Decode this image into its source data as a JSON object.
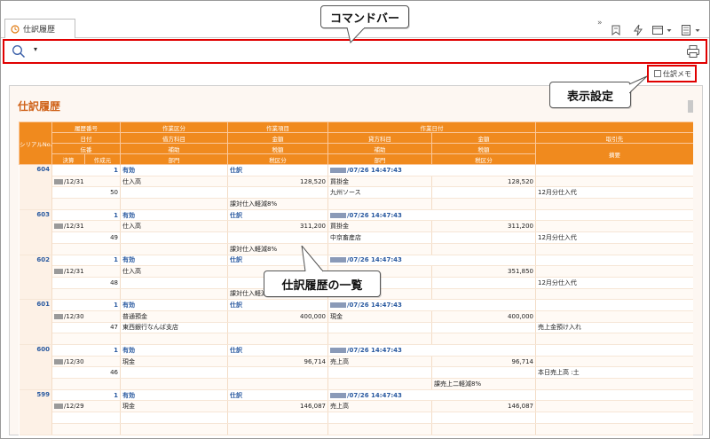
{
  "tab": {
    "label": "仕訳履歴"
  },
  "toolbar": {
    "more": "»"
  },
  "commandbar": {
    "dropdown": "▾"
  },
  "memo": {
    "label": "仕訳メモ"
  },
  "panel": {
    "title": "仕訳履歴"
  },
  "table": {
    "header_row1": [
      "シリアルNo.",
      "履歴番号",
      "作業区分",
      "作業項目",
      "作業日付"
    ],
    "header_row2": [
      "日付",
      "借方科目",
      "金額",
      "貸方科目",
      "金額",
      "取引先"
    ],
    "header_row3": [
      "伝番",
      "補助",
      "税額",
      "補助",
      "税額"
    ],
    "header_row4": [
      "決算",
      "作成元",
      "部門",
      "税区分",
      "部門",
      "税区分",
      "摘要"
    ],
    "records": [
      {
        "serial": "604",
        "hist": "1",
        "kubun": "有効",
        "koumoku": "仕訳",
        "datetime": "/07/26 14:47:43",
        "date": "/12/31",
        "debit": "仕入高",
        "debit_amount": "128,520",
        "credit": "買掛金",
        "credit_amount": "128,520",
        "partner": "",
        "denban": "50",
        "debit_sub": "",
        "debit_tax": "",
        "credit_sub": "九州ソース",
        "credit_tax": "",
        "memo": "12月分仕入代",
        "debit_taxkbn": "課対仕入軽減8%",
        "credit_taxkbn": ""
      },
      {
        "serial": "603",
        "hist": "1",
        "kubun": "有効",
        "koumoku": "仕訳",
        "datetime": "/07/26 14:47:43",
        "date": "/12/31",
        "debit": "仕入高",
        "debit_amount": "311,200",
        "credit": "買掛金",
        "credit_amount": "311,200",
        "partner": "",
        "denban": "49",
        "debit_sub": "",
        "debit_tax": "",
        "credit_sub": "中京畜産店",
        "credit_tax": "",
        "memo": "12月分仕入代",
        "debit_taxkbn": "課対仕入軽減8%",
        "credit_taxkbn": ""
      },
      {
        "serial": "602",
        "hist": "1",
        "kubun": "有効",
        "koumoku": "仕訳",
        "datetime": "/07/26 14:47:43",
        "date": "/12/31",
        "debit": "仕入高",
        "debit_amount": "",
        "credit": "",
        "credit_amount": "351,850",
        "partner": "",
        "denban": "48",
        "debit_sub": "",
        "debit_tax": "",
        "credit_sub": "",
        "credit_tax": "",
        "memo": "12月分仕入代",
        "debit_taxkbn": "課対仕入軽減8%",
        "credit_taxkbn": ""
      },
      {
        "serial": "601",
        "hist": "1",
        "kubun": "有効",
        "koumoku": "仕訳",
        "datetime": "/07/26 14:47:43",
        "date": "/12/30",
        "debit": "普通預金",
        "debit_amount": "400,000",
        "credit": "現金",
        "credit_amount": "400,000",
        "partner": "",
        "denban": "47",
        "debit_sub": "東西銀行なんば支店",
        "debit_tax": "",
        "credit_sub": "",
        "credit_tax": "",
        "memo": "売上金預け入れ",
        "debit_taxkbn": "",
        "credit_taxkbn": ""
      },
      {
        "serial": "600",
        "hist": "1",
        "kubun": "有効",
        "koumoku": "仕訳",
        "datetime": "/07/26 14:47:43",
        "date": "/12/30",
        "debit": "現金",
        "debit_amount": "96,714",
        "credit": "売上高",
        "credit_amount": "96,714",
        "partner": "",
        "denban": "46",
        "debit_sub": "",
        "debit_tax": "",
        "credit_sub": "",
        "credit_tax": "",
        "memo": "本日売上高 :土",
        "debit_taxkbn": "",
        "credit_taxkbn": "課売上二軽減8%"
      },
      {
        "serial": "599",
        "hist": "1",
        "kubun": "有効",
        "koumoku": "仕訳",
        "datetime": "/07/26 14:47:43",
        "date": "/12/29",
        "debit": "現金",
        "debit_amount": "146,087",
        "credit": "売上高",
        "credit_amount": "146,087",
        "partner": "",
        "denban": "",
        "debit_sub": "",
        "debit_tax": "",
        "credit_sub": "",
        "credit_tax": "",
        "memo": "",
        "debit_taxkbn": "",
        "credit_taxkbn": ""
      }
    ]
  },
  "callouts": {
    "commandbar": "コマンドバー",
    "display": "表示設定",
    "list": "仕訳履歴の一覧"
  }
}
